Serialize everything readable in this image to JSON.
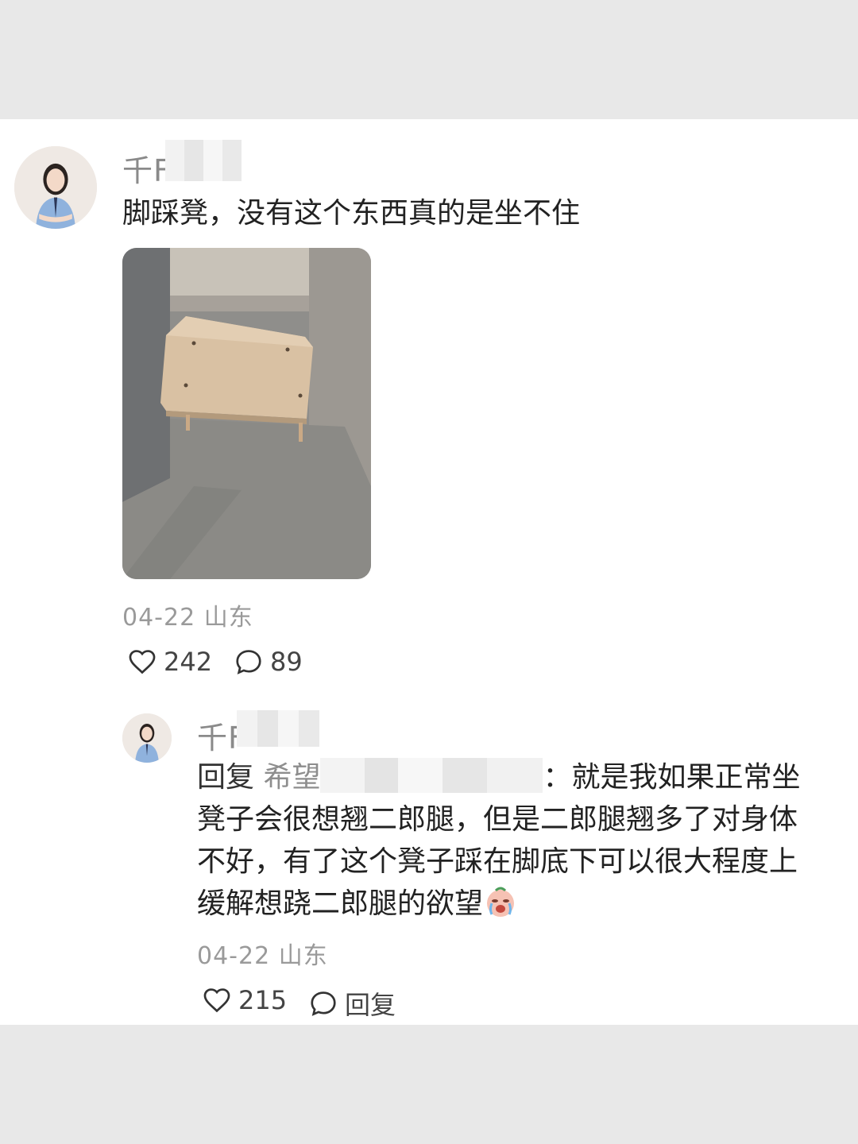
{
  "comment": {
    "username": "千F",
    "text": "脚踩凳，没有这个东西真的是坐不住",
    "date_location": "04-22 山东",
    "likes": "242",
    "replies": "89"
  },
  "reply": {
    "username": "千F",
    "prefix": "回复",
    "reply_to": "希望",
    "colon_text": "：就是我如果正常坐凳子会很想翘二郎腿，但是二郎腿翘多了对身体不好，有了这个凳子踩在脚底下可以很大程度上缓解想跷二郎腿的欲望",
    "emoji_name": "crying-face-emoji",
    "date_location": "04-22 山东",
    "likes": "215",
    "reply_label": "回复"
  },
  "icons": {
    "like": "heart-icon",
    "comment": "speech-bubble-icon"
  },
  "colors": {
    "background": "#e8e8e8",
    "card": "#ffffff",
    "text": "#222222",
    "meta": "#9a9a9a"
  }
}
